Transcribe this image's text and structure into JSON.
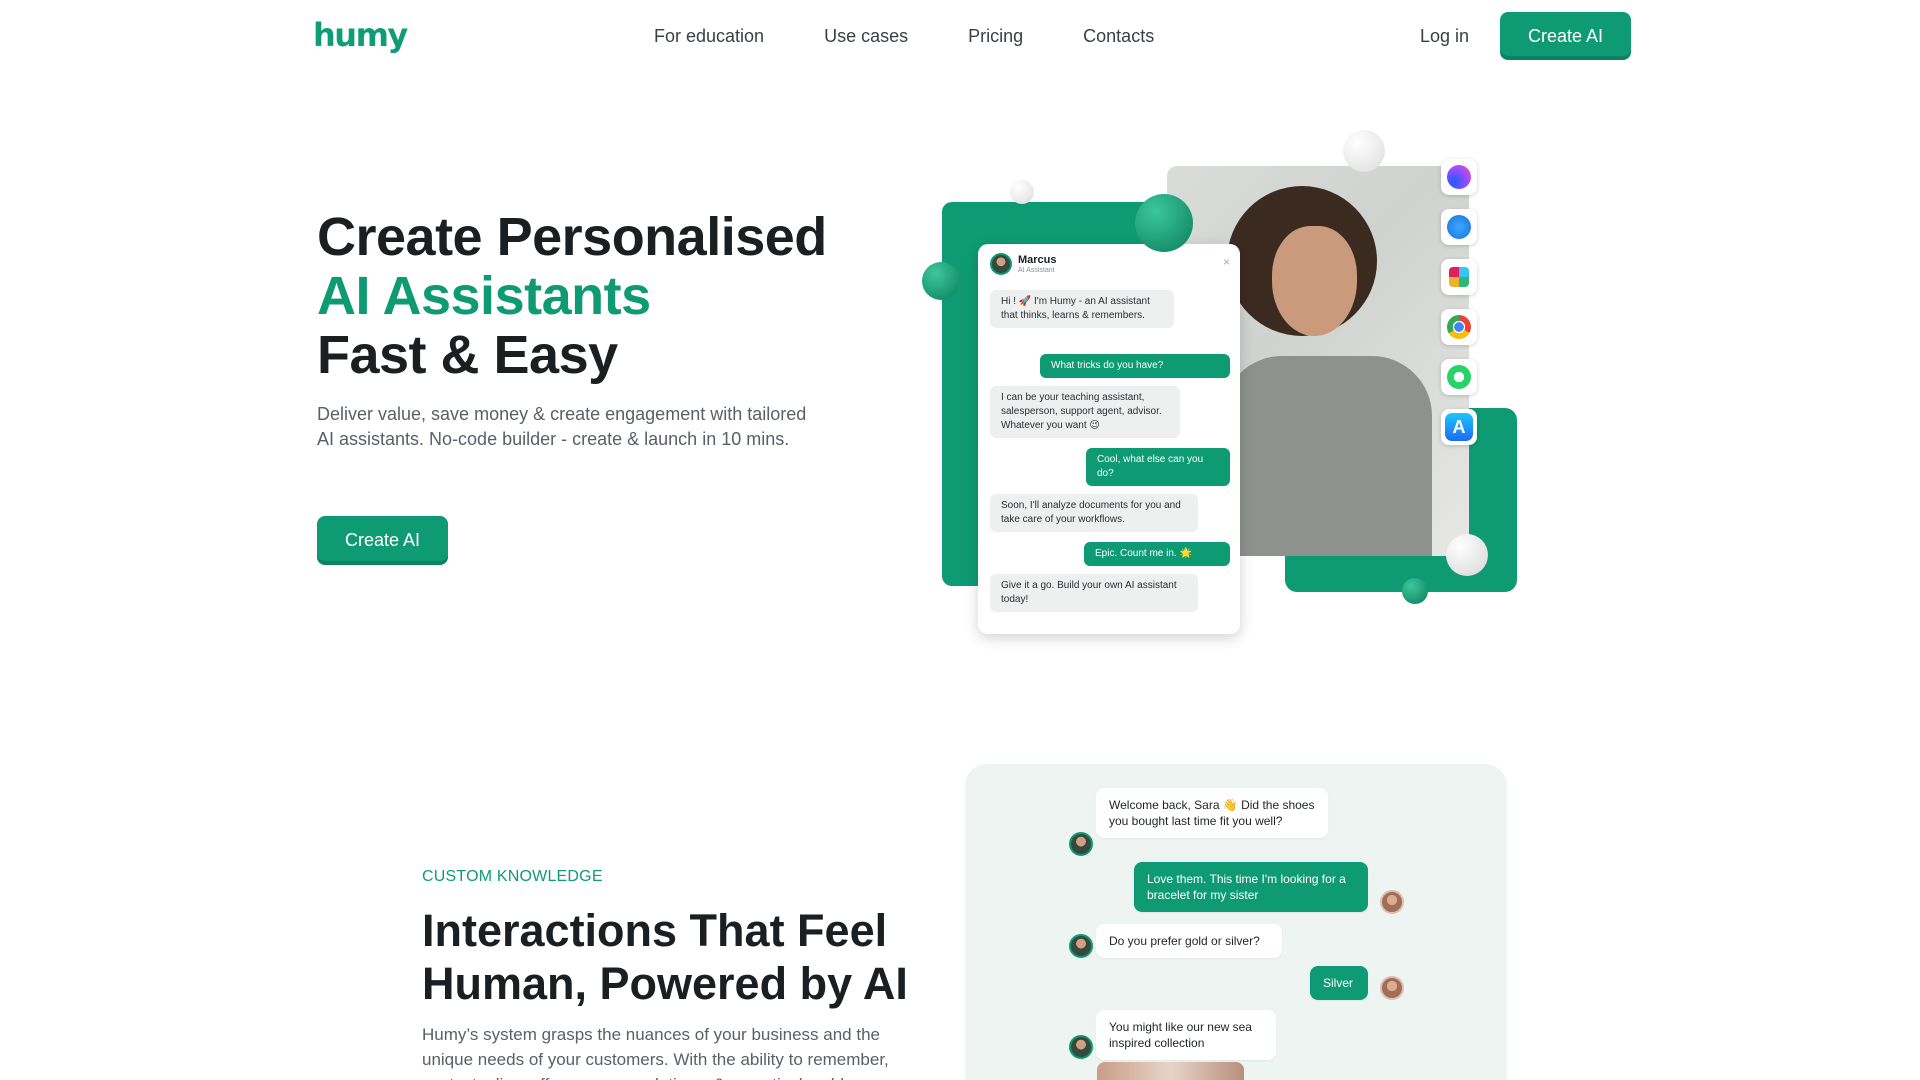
{
  "nav": {
    "logo": "humy",
    "links": [
      "For education",
      "Use cases",
      "Pricing",
      "Contacts"
    ],
    "login": "Log in",
    "cta": "Create AI"
  },
  "hero": {
    "title_line1": "Create Personalised",
    "title_line2": "AI Assistants",
    "title_line3": "Fast & Easy",
    "description": "Deliver value, save money & create engagement with tailored AI assistants. No-code builder - create & launch in 10 mins.",
    "cta": "Create AI"
  },
  "widget": {
    "name": "Marcus",
    "role": "AI Assistant",
    "close": "×",
    "messages": [
      {
        "from": "bot",
        "text": "Hi ! 🚀 I'm Humy - an AI assistant that thinks, learns & remembers."
      },
      {
        "from": "user",
        "text": "What tricks do you have?"
      },
      {
        "from": "bot",
        "text": "I can be your teaching assistant, salesperson, support agent, advisor. Whatever you want 😉"
      },
      {
        "from": "user",
        "text": "Cool, what else can you do?"
      },
      {
        "from": "bot",
        "text": "Soon, I'll analyze documents for you and take care of your workflows."
      },
      {
        "from": "user",
        "text": "Epic. Count me in. 🌟"
      },
      {
        "from": "bot",
        "text": "Give it a go. Build your own AI assistant today!"
      }
    ]
  },
  "app_icons": [
    "messenger-icon",
    "safari-icon",
    "slack-icon",
    "chrome-icon",
    "whatsapp-icon",
    "app-store-icon"
  ],
  "section2": {
    "eyebrow": "CUSTOM KNOWLEDGE",
    "title_line1": "Interactions That Feel",
    "title_line2": "Human, Powered by AI",
    "description": "Humy’s system grasps the nuances of your business and the unique needs of your customers. With the ability to remember, contextualise, offer recommendations, & proactively address",
    "chat": [
      {
        "from": "bot",
        "text": "Welcome back, Sara 👋 Did the shoes you bought last time fit you well?"
      },
      {
        "from": "user",
        "text": "Love them. This time I'm looking for a bracelet for my sister"
      },
      {
        "from": "bot",
        "text": "Do you prefer gold or silver?"
      },
      {
        "from": "user",
        "text": "Silver"
      },
      {
        "from": "bot",
        "text": "You might like our new sea inspired collection"
      }
    ]
  },
  "colors": {
    "accent": "#0e9b73",
    "text_dark": "#1c1f22",
    "text_muted": "#5a6068",
    "panel_bg": "#eef4f2"
  }
}
